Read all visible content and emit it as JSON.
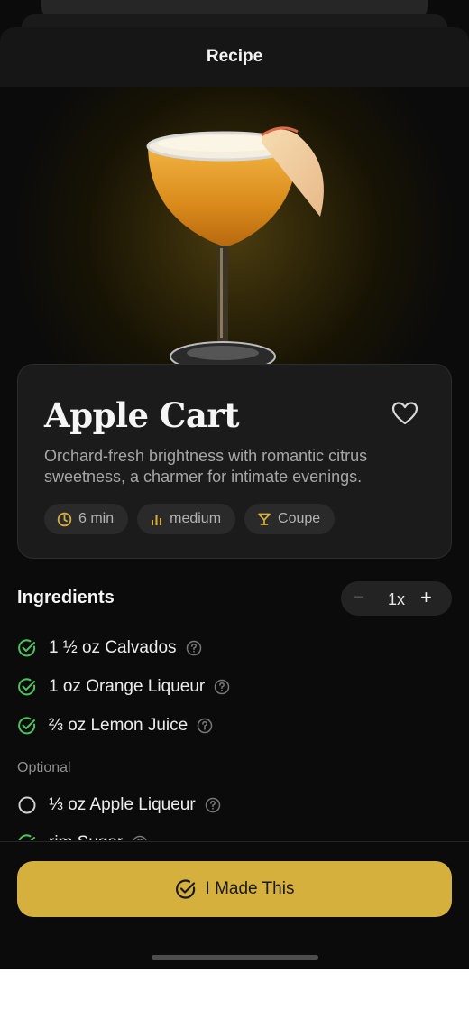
{
  "header": {
    "title": "Recipe"
  },
  "drink": {
    "name": "Apple Cart",
    "description": "Orchard-fresh brightness with romantic citrus sweetness, a charmer for intimate evenings.",
    "chips": [
      {
        "icon": "clock-icon",
        "label": "6 min"
      },
      {
        "icon": "difficulty-bars-icon",
        "label": "medium"
      },
      {
        "icon": "cocktail-glass-icon",
        "label": "Coupe"
      }
    ]
  },
  "ingredients": {
    "title": "Ingredients",
    "serving": {
      "value": "1x",
      "minus": "−",
      "plus": "+"
    },
    "required": [
      {
        "text": "1 ½ oz Calvados",
        "checked": true
      },
      {
        "text": "1 oz Orange Liqueur",
        "checked": true
      },
      {
        "text": "⅔ oz Lemon Juice",
        "checked": true
      }
    ],
    "optional_label": "Optional",
    "optional": [
      {
        "text": "⅓ oz Apple Liqueur",
        "checked": false
      },
      {
        "text": "rim Sugar",
        "checked": true
      }
    ]
  },
  "action": {
    "made_this_label": "I Made This"
  },
  "colors": {
    "accent": "#d6b03c",
    "check_green": "#4cc25a",
    "background": "#0b0b0b"
  }
}
